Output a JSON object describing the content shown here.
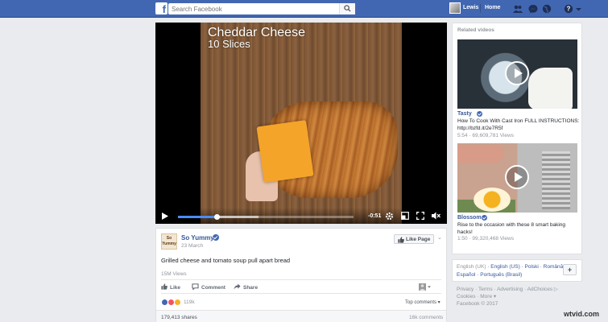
{
  "topbar": {
    "logo": "f",
    "search_placeholder": "Search Facebook",
    "user_name": "Lewis",
    "home_label": "Home"
  },
  "video": {
    "overlay_title": "Cheddar Cheese",
    "overlay_subtitle": "10 Slices",
    "time_remaining": "-0:51",
    "progress": 0.22,
    "buffered": 0.46
  },
  "post": {
    "page_name": "So Yummy",
    "avatar_text": "So Yummy",
    "date": "23 March",
    "like_page_label": "Like Page",
    "caret": "⌄",
    "text": "Grilled cheese and tomato soup pull apart bread",
    "views": "15M Views",
    "actions": {
      "like": "Like",
      "comment": "Comment",
      "share": "Share"
    },
    "reaction_count": "119k",
    "top_comments": "Top comments ▾",
    "shares": "179,413 shares",
    "comments": "16k comments"
  },
  "related": {
    "title": "Related videos",
    "items": [
      {
        "source": "Tasty",
        "description": "How To Cook With Cast Iron FULL INSTRUCTIONS: http://bzfd.it/2e7R5f",
        "meta": "5:54 · 69,609,781 Views"
      },
      {
        "source": "Blossom",
        "description": "Rise to the occasion with these 8 smart baking hacks!",
        "meta": "1:50 · 99,320,468 Views"
      }
    ]
  },
  "languages": {
    "line1": [
      "English (UK)",
      "English (US)",
      "Polski",
      "Română"
    ],
    "line2": [
      "Español",
      "Português (Brasil)"
    ],
    "plus": "+"
  },
  "footer": {
    "line1": "Privacy · Terms · Advertising · AdChoices ▷",
    "line2": "Cookies · More ▾",
    "line3": "Facebook © 2017"
  },
  "watermark": "wtvid.com",
  "colors": {
    "brand_blue": "#4267b2",
    "link_blue": "#365899",
    "progress_blue": "#4b8cf5",
    "background": "#e9ebee"
  }
}
